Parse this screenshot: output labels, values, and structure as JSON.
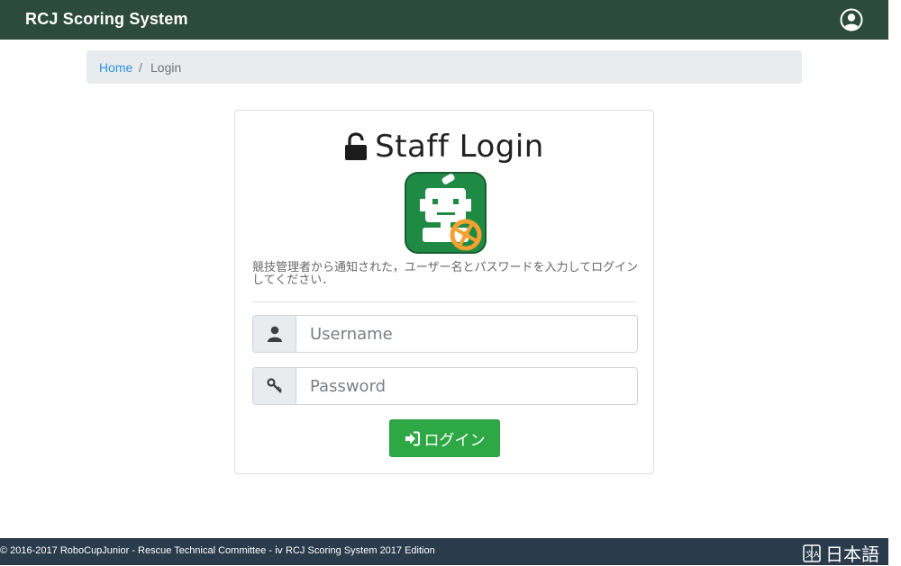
{
  "navbar": {
    "brand": "RCJ Scoring System",
    "user_icon": "user-circle-icon",
    "bg_color": "#2c4a3e"
  },
  "breadcrumb": {
    "home": "Home",
    "separator": "/",
    "current": "Login"
  },
  "login_card": {
    "title": "Staff Login",
    "title_icon": "unlock-icon",
    "logo_icon": "robot-logo-icon",
    "description": "競技管理者から通知された，ユーザー名とパスワードを入力してログインしてください．",
    "username": {
      "value": "",
      "placeholder": "Username",
      "icon": "user-icon"
    },
    "password": {
      "value": "",
      "placeholder": "Password",
      "icon": "key-icon"
    },
    "login_button": {
      "label": "ログイン",
      "icon": "sign-in-icon",
      "color": "#2ea845"
    }
  },
  "footer": {
    "copyright": "© 2016-2017 RoboCupJunior - Rescue Technical Committee - ⅳ RCJ Scoring System 2017 Edition",
    "language_label": "日本語",
    "language_icon": "translate-icon",
    "bg_color": "#2a3b4c"
  }
}
